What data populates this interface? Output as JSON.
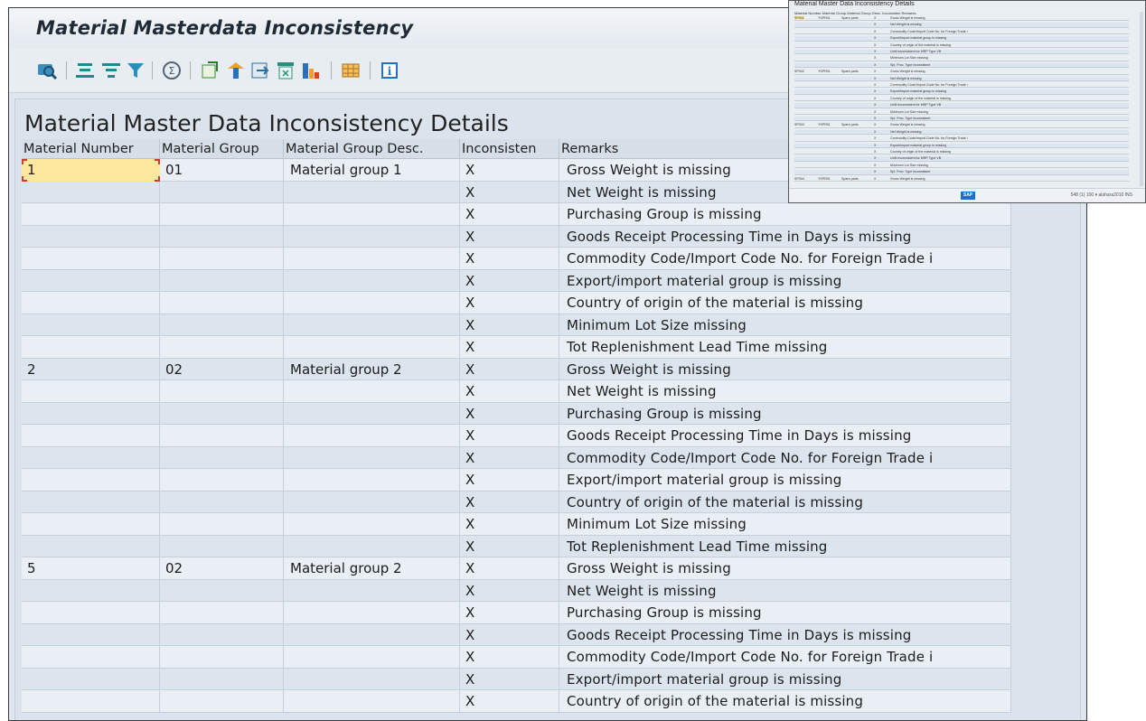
{
  "window": {
    "title": "Material Masterdata Inconsistency"
  },
  "toolbar": {
    "icons": [
      "details-icon",
      "sort-ascending-icon",
      "sort-descending-icon",
      "filter-icon",
      "total-icon",
      "export-icon",
      "layout-icon",
      "print-preview-icon",
      "upload-icon",
      "spreadsheet-icon",
      "graphic-icon",
      "grid-icon",
      "info-icon"
    ]
  },
  "report": {
    "title": "Material Master Data Inconsistency Details"
  },
  "table": {
    "columns": [
      "Material Number",
      "Material Group",
      "Material Group Desc.",
      "Inconsisten",
      "Remarks"
    ],
    "rows": [
      {
        "mat": "1",
        "grp": "01",
        "desc": "Material group 1",
        "inc": "X",
        "rem": "Gross Weight is missing"
      },
      {
        "mat": "",
        "grp": "",
        "desc": "",
        "inc": "X",
        "rem": "Net Weight is missing"
      },
      {
        "mat": "",
        "grp": "",
        "desc": "",
        "inc": "X",
        "rem": "Purchasing Group is missing"
      },
      {
        "mat": "",
        "grp": "",
        "desc": "",
        "inc": "X",
        "rem": "Goods Receipt Processing Time in Days is missing"
      },
      {
        "mat": "",
        "grp": "",
        "desc": "",
        "inc": "X",
        "rem": "Commodity Code/Import Code No. for Foreign Trade i"
      },
      {
        "mat": "",
        "grp": "",
        "desc": "",
        "inc": "X",
        "rem": "Export/import material group is missing"
      },
      {
        "mat": "",
        "grp": "",
        "desc": "",
        "inc": "X",
        "rem": "Country of origin of the material is missing"
      },
      {
        "mat": "",
        "grp": "",
        "desc": "",
        "inc": "X",
        "rem": "Minimum Lot Size missing"
      },
      {
        "mat": "",
        "grp": "",
        "desc": "",
        "inc": "X",
        "rem": "Tot Replenishment Lead Time missing"
      },
      {
        "mat": "2",
        "grp": "02",
        "desc": "Material group 2",
        "inc": "X",
        "rem": "Gross Weight is missing"
      },
      {
        "mat": "",
        "grp": "",
        "desc": "",
        "inc": "X",
        "rem": "Net Weight is missing"
      },
      {
        "mat": "",
        "grp": "",
        "desc": "",
        "inc": "X",
        "rem": "Purchasing Group is missing"
      },
      {
        "mat": "",
        "grp": "",
        "desc": "",
        "inc": "X",
        "rem": "Goods Receipt Processing Time in Days is missing"
      },
      {
        "mat": "",
        "grp": "",
        "desc": "",
        "inc": "X",
        "rem": "Commodity Code/Import Code No. for Foreign Trade i"
      },
      {
        "mat": "",
        "grp": "",
        "desc": "",
        "inc": "X",
        "rem": "Export/import material group is missing"
      },
      {
        "mat": "",
        "grp": "",
        "desc": "",
        "inc": "X",
        "rem": "Country of origin of the material is missing"
      },
      {
        "mat": "",
        "grp": "",
        "desc": "",
        "inc": "X",
        "rem": "Minimum Lot Size missing"
      },
      {
        "mat": "",
        "grp": "",
        "desc": "",
        "inc": "X",
        "rem": "Tot Replenishment Lead Time missing"
      },
      {
        "mat": "5",
        "grp": "02",
        "desc": "Material group 2",
        "inc": "X",
        "rem": "Gross Weight is missing"
      },
      {
        "mat": "",
        "grp": "",
        "desc": "",
        "inc": "X",
        "rem": "Net Weight is missing"
      },
      {
        "mat": "",
        "grp": "",
        "desc": "",
        "inc": "X",
        "rem": "Purchasing Group is missing"
      },
      {
        "mat": "",
        "grp": "",
        "desc": "",
        "inc": "X",
        "rem": "Goods Receipt Processing Time in Days is missing"
      },
      {
        "mat": "",
        "grp": "",
        "desc": "",
        "inc": "X",
        "rem": "Commodity Code/Import Code No. for Foreign Trade i"
      },
      {
        "mat": "",
        "grp": "",
        "desc": "",
        "inc": "X",
        "rem": "Export/import material group is missing"
      },
      {
        "mat": "",
        "grp": "",
        "desc": "",
        "inc": "X",
        "rem": "Country of origin of the material is missing"
      }
    ]
  },
  "inset": {
    "title": "Material Master Data Inconsistency Details",
    "header": "Material Number Material Group Material Group Desc. Inconsisten Remarks",
    "rows": [
      {
        "mat": "SP001",
        "grp": "YSPR01",
        "desc": "Spare parts",
        "inc": "X",
        "rem": "Gross Weight is missing"
      },
      {
        "mat": "",
        "grp": "",
        "desc": "",
        "inc": "X",
        "rem": "Net Weight is missing"
      },
      {
        "mat": "",
        "grp": "",
        "desc": "",
        "inc": "X",
        "rem": "Commodity Code/Import Code No. for Foreign Trade i"
      },
      {
        "mat": "",
        "grp": "",
        "desc": "",
        "inc": "X",
        "rem": "Export/import material group is missing"
      },
      {
        "mat": "",
        "grp": "",
        "desc": "",
        "inc": "X",
        "rem": "Country of origin of the material is missing"
      },
      {
        "mat": "",
        "grp": "",
        "desc": "",
        "inc": "X",
        "rem": "UoM inconsistent for MRP Type VB"
      },
      {
        "mat": "",
        "grp": "",
        "desc": "",
        "inc": "X",
        "rem": "Minimum Lot Size missing"
      },
      {
        "mat": "",
        "grp": "",
        "desc": "",
        "inc": "X",
        "rem": "Spl. Proc. Type inconsistent"
      },
      {
        "mat": "SP002",
        "grp": "YSPR01",
        "desc": "Spare parts",
        "inc": "X",
        "rem": "Gross Weight is missing"
      },
      {
        "mat": "",
        "grp": "",
        "desc": "",
        "inc": "X",
        "rem": "Net Weight is missing"
      },
      {
        "mat": "",
        "grp": "",
        "desc": "",
        "inc": "X",
        "rem": "Commodity Code/Import Code No. for Foreign Trade i"
      },
      {
        "mat": "",
        "grp": "",
        "desc": "",
        "inc": "X",
        "rem": "Export/import material group is missing"
      },
      {
        "mat": "",
        "grp": "",
        "desc": "",
        "inc": "X",
        "rem": "Country of origin of the material is missing"
      },
      {
        "mat": "",
        "grp": "",
        "desc": "",
        "inc": "X",
        "rem": "UoM inconsistent for MRP Type VB"
      },
      {
        "mat": "",
        "grp": "",
        "desc": "",
        "inc": "X",
        "rem": "Minimum Lot Size missing"
      },
      {
        "mat": "",
        "grp": "",
        "desc": "",
        "inc": "X",
        "rem": "Spl. Proc. Type inconsistent"
      },
      {
        "mat": "SP003",
        "grp": "YSPR01",
        "desc": "Spare parts",
        "inc": "X",
        "rem": "Gross Weight is missing"
      },
      {
        "mat": "",
        "grp": "",
        "desc": "",
        "inc": "X",
        "rem": "Net Weight is missing"
      },
      {
        "mat": "",
        "grp": "",
        "desc": "",
        "inc": "X",
        "rem": "Commodity Code/Import Code No. for Foreign Trade i"
      },
      {
        "mat": "",
        "grp": "",
        "desc": "",
        "inc": "X",
        "rem": "Export/import material group is missing"
      },
      {
        "mat": "",
        "grp": "",
        "desc": "",
        "inc": "X",
        "rem": "Country of origin of the material is missing"
      },
      {
        "mat": "",
        "grp": "",
        "desc": "",
        "inc": "X",
        "rem": "UoM inconsistent for MRP Type VB"
      },
      {
        "mat": "",
        "grp": "",
        "desc": "",
        "inc": "X",
        "rem": "Minimum Lot Size missing"
      },
      {
        "mat": "",
        "grp": "",
        "desc": "",
        "inc": "X",
        "rem": "Spl. Proc. Type inconsistent"
      },
      {
        "mat": "SP004",
        "grp": "YSPR01",
        "desc": "Spare parts",
        "inc": "X",
        "rem": "Gross Weight is missing"
      }
    ],
    "status": "548 (1) 100 ▾  alahara2010  INS",
    "logo": "SAP"
  }
}
